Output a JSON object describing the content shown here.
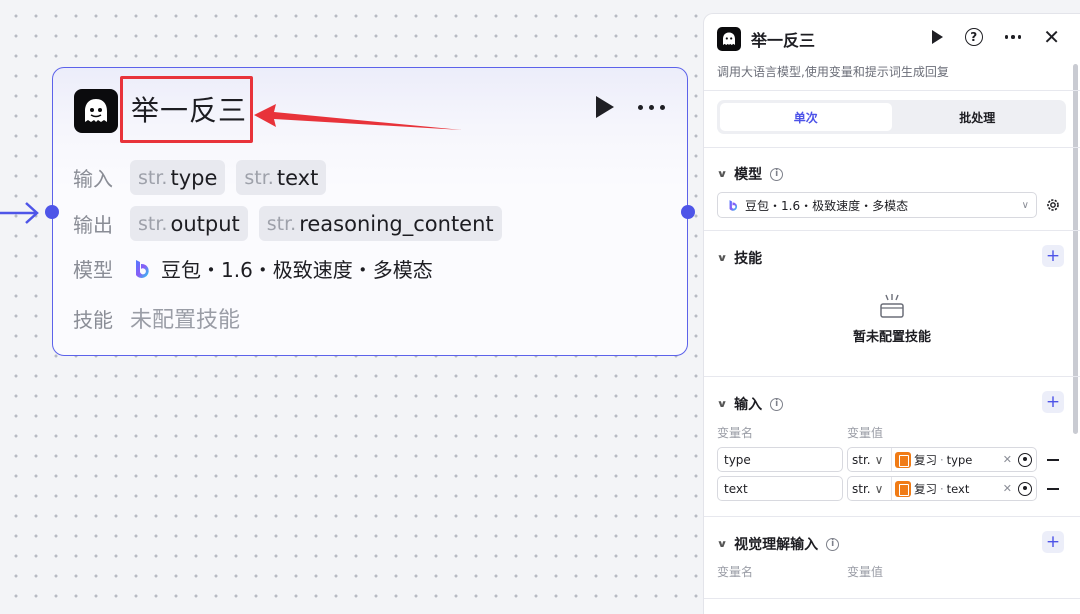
{
  "node": {
    "title": "举一反三",
    "inputs_label": "输入",
    "inputs": [
      {
        "prefix": "str.",
        "name": "type"
      },
      {
        "prefix": "str.",
        "name": "text"
      }
    ],
    "outputs_label": "输出",
    "outputs": [
      {
        "prefix": "str.",
        "name": "output"
      },
      {
        "prefix": "str.",
        "name": "reasoning_content"
      }
    ],
    "model_label": "模型",
    "model_value": "豆包・1.6・极致速度・多模态",
    "skills_label": "技能",
    "skills_value": "未配置技能"
  },
  "panel": {
    "title": "举一反三",
    "description": "调用大语言模型,使用变量和提示词生成回复",
    "tabs": [
      "单次",
      "批处理"
    ],
    "active_tab": "单次",
    "model_section": {
      "title": "模型",
      "selected": "豆包・1.6・极致速度・多模态"
    },
    "skills_section": {
      "title": "技能",
      "empty_text": "暂未配置技能"
    },
    "input_section": {
      "title": "输入",
      "col_name": "变量名",
      "col_value": "变量值",
      "rows": [
        {
          "name": "type",
          "type": "str.",
          "ref_node": "复习",
          "ref_sep": "·",
          "ref_var": "type"
        },
        {
          "name": "text",
          "type": "str.",
          "ref_node": "复习",
          "ref_sep": "·",
          "ref_var": "text"
        }
      ]
    },
    "vision_section": {
      "title": "视觉理解输入",
      "col_name": "变量名",
      "col_value": "变量值"
    }
  },
  "colors": {
    "accent": "#4d53e8",
    "node_border": "#5c62ea",
    "highlight_red": "#e8333a",
    "ref_orange": "#f07b16"
  }
}
